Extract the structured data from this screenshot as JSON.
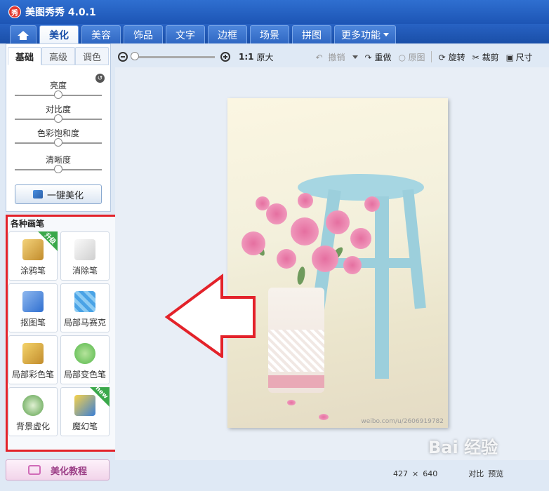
{
  "app": {
    "logo_text": "秀",
    "title": "美图秀秀 4.0.1"
  },
  "tabs": [
    {
      "label": "美化"
    },
    {
      "label": "美容"
    },
    {
      "label": "饰品"
    },
    {
      "label": "文字"
    },
    {
      "label": "边框"
    },
    {
      "label": "场景"
    },
    {
      "label": "拼图"
    },
    {
      "label": "更多功能"
    }
  ],
  "sub_tabs": [
    {
      "label": "基础"
    },
    {
      "label": "高级"
    },
    {
      "label": "调色"
    }
  ],
  "sliders": [
    {
      "label": "亮度",
      "value": 0.5
    },
    {
      "label": "对比度",
      "value": 0.5
    },
    {
      "label": "色彩饱和度",
      "value": 0.5
    },
    {
      "label": "清晰度",
      "value": 0.5
    }
  ],
  "beautify_button": "一键美化",
  "brushes": {
    "heading": "各种画笔",
    "items": [
      {
        "label": "涂鸦笔",
        "badge": "升级",
        "color": "#d4a233"
      },
      {
        "label": "消除笔",
        "badge": "",
        "color": "#e6e6e6"
      },
      {
        "label": "抠图笔",
        "badge": "",
        "color": "#2f6fd0"
      },
      {
        "label": "局部马赛克",
        "badge": "",
        "color": "#4aa3e6"
      },
      {
        "label": "局部彩色笔",
        "badge": "",
        "color": "#c28c2c"
      },
      {
        "label": "局部变色笔",
        "badge": "",
        "color": "#55b84a"
      },
      {
        "label": "背景虚化",
        "badge": "",
        "color": "#5aa04a"
      },
      {
        "label": "魔幻笔",
        "badge": "new",
        "color": "#3b7fd6"
      }
    ]
  },
  "tutorial_button": "美化教程",
  "toolbar": {
    "zoom_label": "1:1",
    "original_size": "原大",
    "undo": "撤销",
    "redo": "重做",
    "original": "原图",
    "rotate": "旋转",
    "crop": "裁剪",
    "resize": "尺寸"
  },
  "photo": {
    "watermark": "weibo.com/u/2606919782"
  },
  "status": {
    "width": "427",
    "times": "×",
    "height": "640",
    "compare": "对比",
    "preview": "预览"
  },
  "baidu_watermark": "Bai 经验"
}
